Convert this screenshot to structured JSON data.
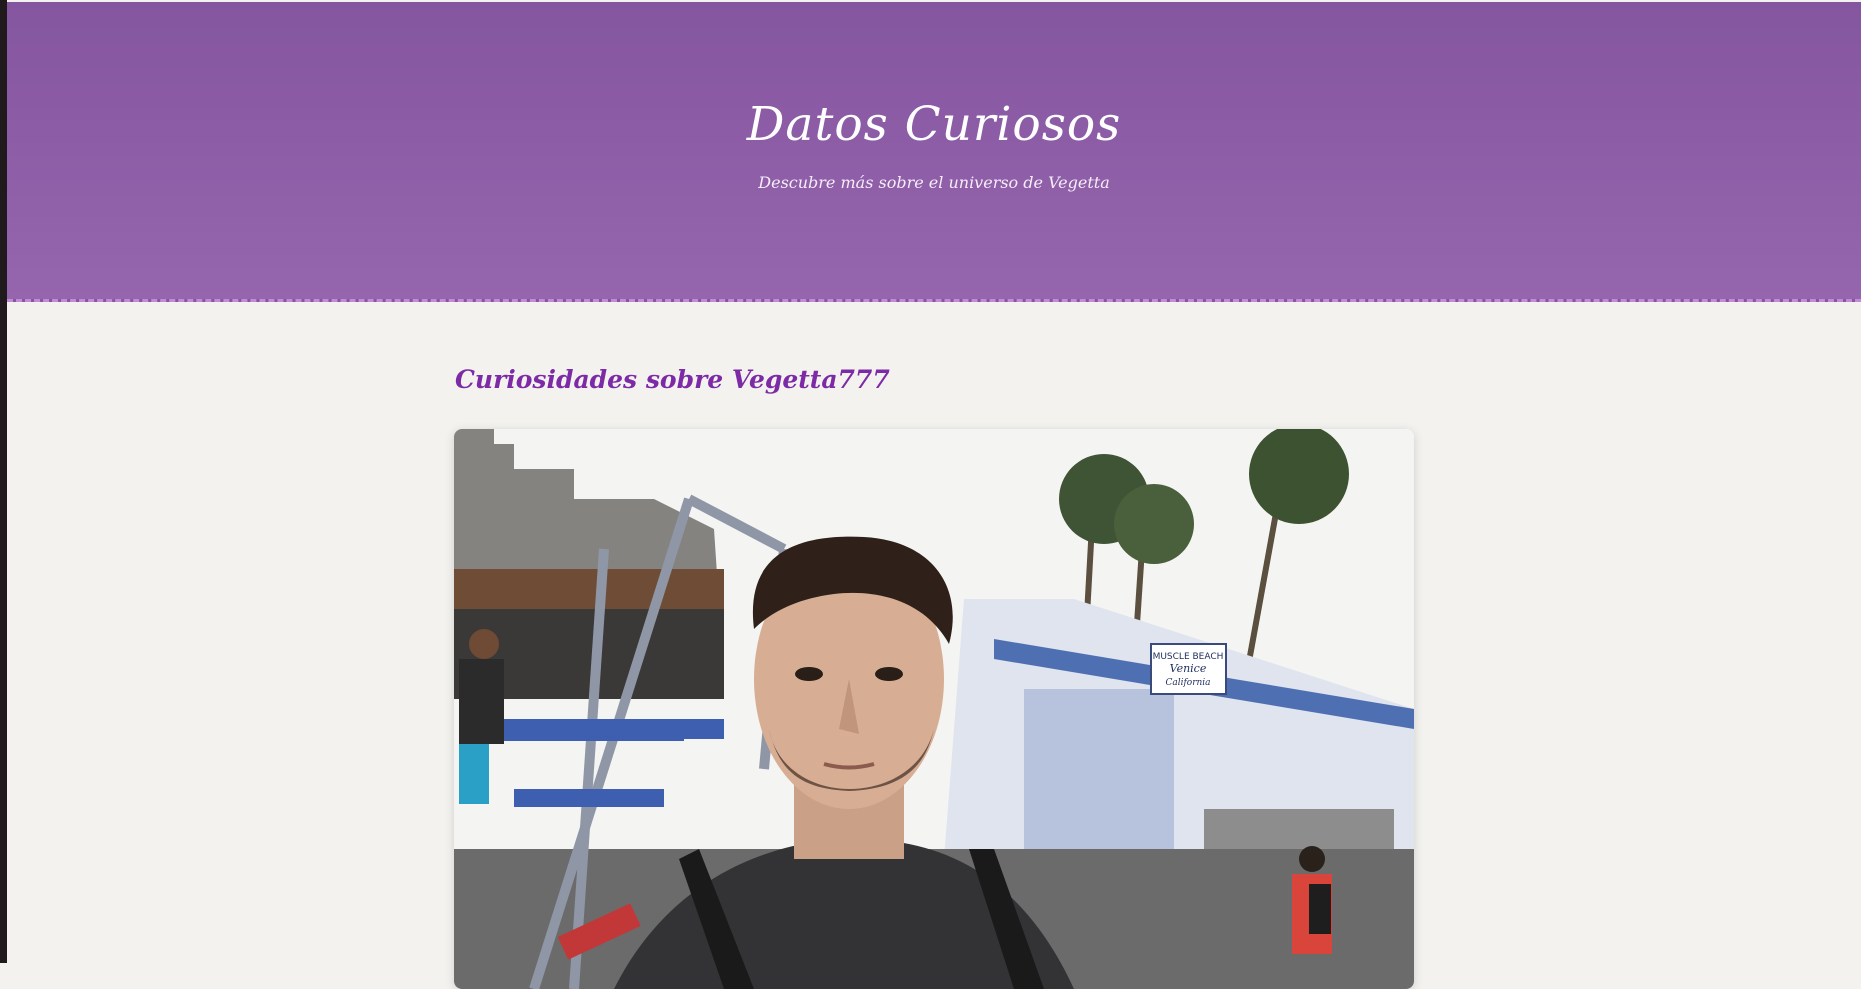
{
  "header": {
    "title": "Datos Curiosos",
    "subtitle": "Descubre más sobre el universo de Vegetta"
  },
  "main": {
    "section_title": "Curiosidades sobre Vegetta777",
    "photo": {
      "sign_lines": [
        "MUSCLE BEACH",
        "Venice",
        "California"
      ]
    }
  },
  "colors": {
    "header_start": "#8556a0",
    "header_end": "#9565ad",
    "section_title": "#7d2aa6",
    "page_background": "#f3f2ef"
  }
}
